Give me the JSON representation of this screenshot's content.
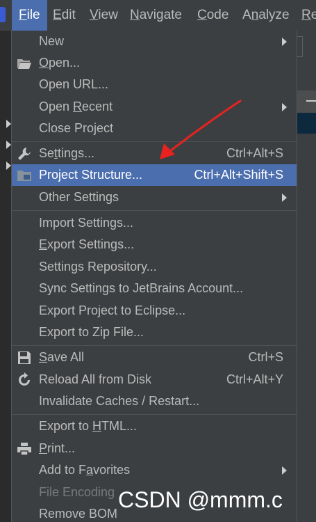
{
  "menubar": {
    "items": [
      {
        "label": "File",
        "mnemonic": "F",
        "rest": "ile",
        "active": true
      },
      {
        "label": "Edit",
        "mnemonic": "E",
        "rest": "dit"
      },
      {
        "label": "View",
        "mnemonic": "V",
        "rest": "iew"
      },
      {
        "label": "Navigate",
        "mnemonic": "N",
        "rest": "avigate"
      },
      {
        "label": "Code",
        "mnemonic": "C",
        "rest": "ode"
      },
      {
        "label": "Analyze",
        "pre": "A",
        "mnemonic": "n",
        "rest": "alyze"
      },
      {
        "label": "Re",
        "mnemonic": "R",
        "rest": "e"
      }
    ]
  },
  "file_menu": {
    "new": {
      "label": "New"
    },
    "open": {
      "pre": "",
      "mn": "O",
      "post": "pen..."
    },
    "open_url": {
      "label": "Open URL..."
    },
    "open_recent": {
      "pre": "Open ",
      "mn": "R",
      "post": "ecent"
    },
    "close_project": {
      "label": "Close Project"
    },
    "settings": {
      "pre": "Se",
      "mn": "t",
      "post": "tings...",
      "shortcut": "Ctrl+Alt+S"
    },
    "project_structure": {
      "label": "Project Structure...",
      "shortcut": "Ctrl+Alt+Shift+S"
    },
    "other_settings": {
      "label": "Other Settings"
    },
    "import_settings": {
      "label": "Import Settings..."
    },
    "export_settings": {
      "pre": "",
      "mn": "E",
      "post": "xport Settings..."
    },
    "settings_repository": {
      "label": "Settings Repository..."
    },
    "sync_settings": {
      "label": "Sync Settings to JetBrains Account..."
    },
    "export_eclipse": {
      "label": "Export Project to Eclipse..."
    },
    "export_zip": {
      "label": "Export to Zip File..."
    },
    "save_all": {
      "pre": "",
      "mn": "S",
      "post": "ave All",
      "shortcut": "Ctrl+S"
    },
    "reload_all": {
      "label": "Reload All from Disk",
      "shortcut": "Ctrl+Alt+Y"
    },
    "invalidate_caches": {
      "label": "Invalidate Caches / Restart..."
    },
    "export_html": {
      "pre": "Export to ",
      "mn": "H",
      "post": "TML..."
    },
    "print": {
      "pre": "",
      "mn": "P",
      "post": "rint..."
    },
    "add_favorites": {
      "pre": "Add to F",
      "mn": "a",
      "post": "vorites"
    },
    "file_encoding": {
      "label": "File Encoding"
    },
    "remove_bom": {
      "label": "Remove BOM"
    }
  },
  "watermark": {
    "text": "CSDN @mmm.c"
  },
  "colors": {
    "selection": "#4b6eaf",
    "background": "#3c3f41",
    "annotation_arrow": "#e8231f"
  }
}
